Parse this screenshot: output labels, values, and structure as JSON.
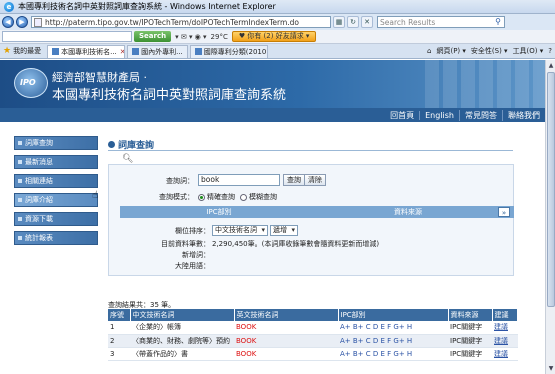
{
  "window": {
    "title": "本國專利技術名詞中英對照詞庫查詢系統 - Windows Internet Explorer",
    "url": "http://paterm.tipo.gov.tw/IPOTechTerm/doIPOTechTermIndexTerm.do",
    "search_placeholder": "Search Results"
  },
  "toolbar": {
    "search_button": "Search",
    "weather": "29°C",
    "promo": "♥ 你有 (2) 好友請求 ▾"
  },
  "tabs": {
    "favorites_label": "我的最愛",
    "items": [
      {
        "label": "本國專利技術名..."
      },
      {
        "label": "國內外專利..."
      },
      {
        "label": "國際專利分類(2010..."
      }
    ],
    "commands": [
      "網頁(P) ▾",
      "安全性(S) ▾",
      "工具(O) ▾",
      "?"
    ]
  },
  "banner": {
    "logo_text": "IPO",
    "line1": "經濟部智慧財產局 ·",
    "line2": "本國專利技術名詞中英對照詞庫查詢系統"
  },
  "topnav": [
    "回首頁",
    "English",
    "常見問答",
    "聯絡我們"
  ],
  "sidebar": [
    {
      "label": "詞庫查詢"
    },
    {
      "label": "最新消息"
    },
    {
      "label": "相關連結"
    },
    {
      "label": "詞庫介紹"
    },
    {
      "label": "資源下載"
    },
    {
      "label": "統計報表"
    }
  ],
  "form": {
    "title": "詞庫查詢",
    "keyword_label": "查詢詞：",
    "keyword_value": "book",
    "query_button": "查詢",
    "clear_button": "清除",
    "mode_label": "查詢模式：",
    "mode_options": [
      "精確查詢",
      "模糊查詢"
    ],
    "filter_ipc": "IPC部別",
    "filter_source": "資料來源",
    "sort_label": "欄位排序：",
    "sort_field": "中文技術名詞",
    "sort_order": "遞增",
    "total_label": "目前資料筆數：",
    "total_value": "2,290,450筆。(本詞庫收錄筆數會隨資料更新而增減)",
    "new_terms_label": "新增詞：",
    "usage_label": "大陸用語："
  },
  "results": {
    "count_text": "查詢結果共：35 筆。",
    "headers": [
      "序號",
      "中文技術名詞",
      "英文技術名詞",
      "IPC部別",
      "資料來源",
      "建議"
    ],
    "ipc_letters": [
      "A",
      "B",
      "C",
      "D",
      "E",
      "F",
      "G",
      "H"
    ],
    "rows": [
      {
        "no": "1",
        "zh": "〈企業的〉帳簿",
        "en": "BOOK",
        "source": "IPC關鍵字",
        "suggest": "建議"
      },
      {
        "no": "2",
        "zh": "〈商業的、財務、劇院等〉預約",
        "en": "BOOK",
        "source": "IPC關鍵字",
        "suggest": "建議"
      },
      {
        "no": "3",
        "zh": "〈帶蓋作品的〉書",
        "en": "BOOK",
        "source": "IPC關鍵字",
        "suggest": "建議"
      }
    ]
  }
}
